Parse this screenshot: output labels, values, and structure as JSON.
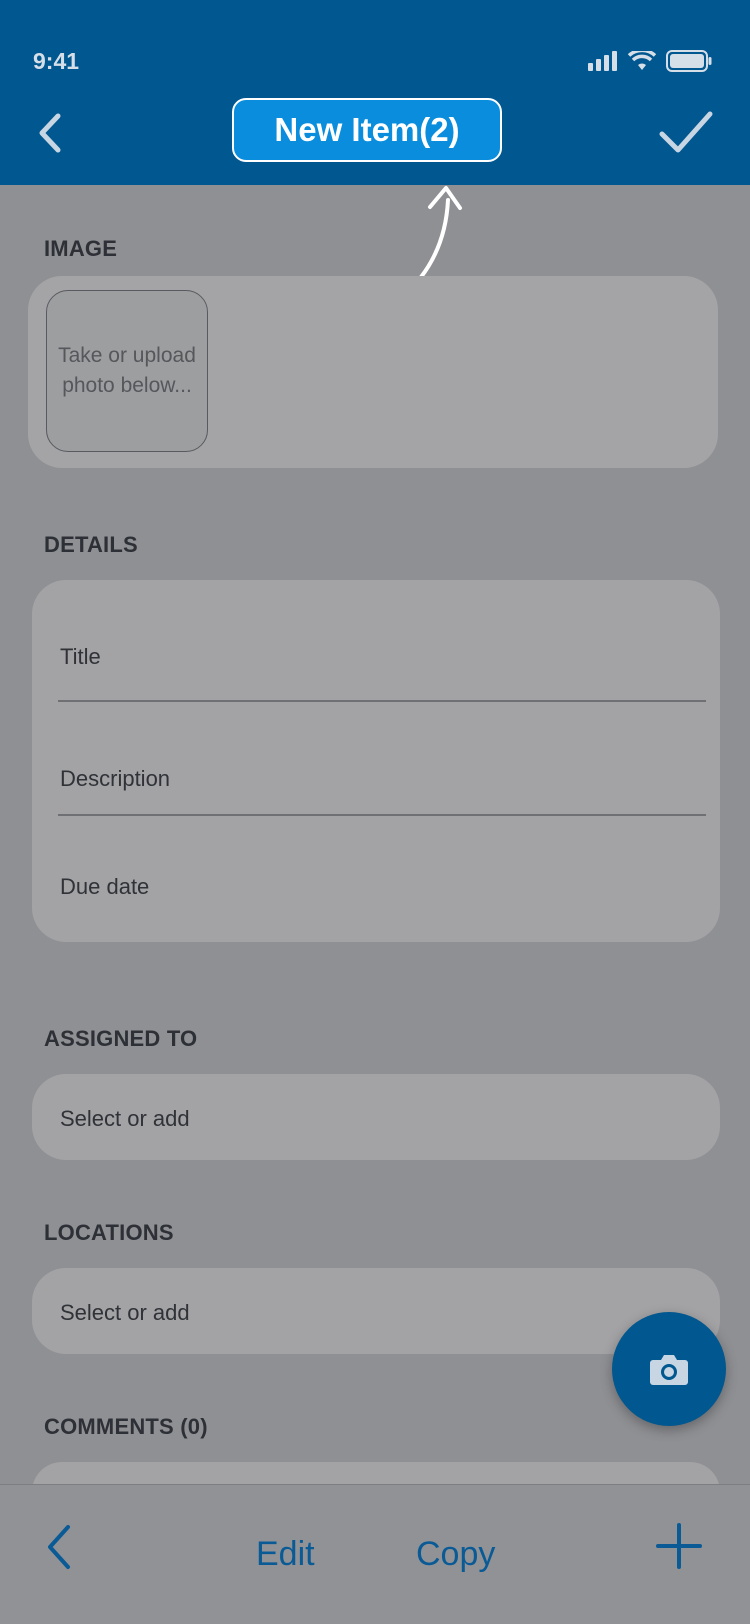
{
  "status_bar": {
    "time": "9:41"
  },
  "header": {
    "title": "New Item(2)"
  },
  "sections": {
    "image": {
      "label": "IMAGE",
      "photo_placeholder": "Take or upload photo below..."
    },
    "details": {
      "label": "DETAILS",
      "fields": [
        "Title",
        "Description",
        "Due date"
      ]
    },
    "assigned_to": {
      "label": "ASSIGNED TO",
      "value": "Select or add"
    },
    "locations": {
      "label": "LOCATIONS",
      "value": "Select or add"
    },
    "comments": {
      "label": "COMMENTS (0)"
    }
  },
  "bottom_bar": {
    "edit_label": "Edit",
    "copy_label": "Copy"
  },
  "colors": {
    "header": "#01578f",
    "accent": "#0a8ddd",
    "bottom_text": "#0a5a95"
  }
}
